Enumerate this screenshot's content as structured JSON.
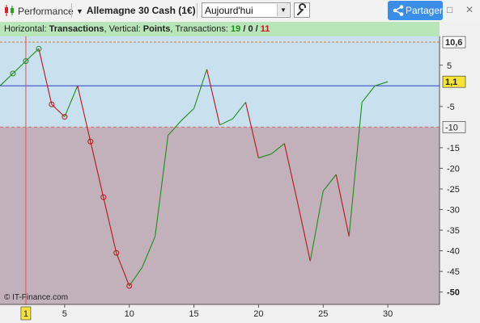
{
  "toolbar": {
    "app_label": "Performance",
    "instrument": "Allemagne 30 Cash (1€)",
    "period": "Aujourd'hui",
    "share_label": "Partager"
  },
  "info_bar": {
    "prefix_h": "Horizontal: ",
    "h_value": "Transactions",
    "prefix_v": ", Vertical: ",
    "v_value": "Points",
    "prefix_t": ", Transactions: ",
    "count_green": "19",
    "slash1": " / ",
    "count_neutral": "0",
    "slash2": " / ",
    "count_red": "11"
  },
  "copyright": "© IT-Finance.com",
  "colors": {
    "gain": "#1e8c1e",
    "loss": "#b41818",
    "positive_zone": "#c9e1ef",
    "negative_zone": "#c2b1bb",
    "reference_line": "#2c3cc8",
    "cursor_line": "#e85050"
  },
  "chart_data": {
    "type": "line",
    "title": "",
    "xlabel": "",
    "ylabel": "",
    "xlim": [
      0,
      34
    ],
    "ylim": [
      -53,
      12
    ],
    "x_ticks": [
      5,
      10,
      15,
      20,
      25,
      30
    ],
    "y_ticks": [
      5,
      -5,
      -15,
      -20,
      -25,
      -30,
      -35,
      -40,
      -45
    ],
    "y_ticks_bold": [
      -50
    ],
    "x": [
      0,
      1,
      2,
      3,
      4,
      5,
      6,
      7,
      8,
      9,
      10,
      11,
      12,
      13,
      14,
      15,
      16,
      17,
      18,
      19,
      20,
      21,
      22,
      23,
      24,
      25,
      26,
      27,
      28,
      29,
      30
    ],
    "y": [
      0,
      3,
      6,
      9,
      -4.5,
      -7.5,
      0,
      -13.5,
      -27,
      -40.5,
      -48.5,
      -44,
      -36.5,
      -12,
      -8.5,
      -5.5,
      4,
      -9.5,
      -8,
      -4,
      -17.5,
      -16.5,
      -14,
      -28,
      -42.5,
      -25.5,
      -21.5,
      -36.5,
      -4,
      0,
      1
    ],
    "markers_at": [
      1,
      2,
      3,
      4,
      5,
      7,
      8,
      9,
      10
    ],
    "max_label": "10,6",
    "last_label": "1,1",
    "drawdown_label": "-10",
    "max_value": 10.6,
    "drawdown_value": -10,
    "cursor_x": 2,
    "cursor_label": "1"
  }
}
